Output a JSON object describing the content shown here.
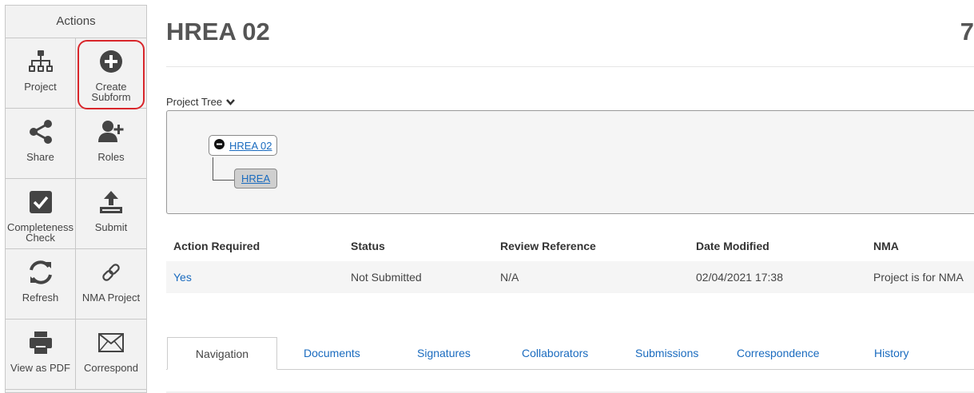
{
  "sidebar": {
    "header": "Actions",
    "items": [
      {
        "label": "Project",
        "icon": "sitemap-icon"
      },
      {
        "label": "Create Subform",
        "icon": "plus-circle-icon"
      },
      {
        "label": "Share",
        "icon": "share-icon"
      },
      {
        "label": "Roles",
        "icon": "user-plus-icon"
      },
      {
        "label": "Completeness Check",
        "icon": "check-square-icon"
      },
      {
        "label": "Submit",
        "icon": "upload-icon"
      },
      {
        "label": "Refresh",
        "icon": "refresh-icon"
      },
      {
        "label": "NMA Project",
        "icon": "link-icon"
      },
      {
        "label": "View as PDF",
        "icon": "print-icon"
      },
      {
        "label": "Correspond",
        "icon": "envelope-icon"
      }
    ]
  },
  "header": {
    "title": "HREA 02",
    "right_number": "7"
  },
  "tree": {
    "label": "Project Tree",
    "root": "HREA 02",
    "child": "HREA"
  },
  "info": {
    "columns": [
      "Action Required",
      "Status",
      "Review Reference",
      "Date Modified",
      "NMA"
    ],
    "row": [
      "Yes",
      "Not Submitted",
      "N/A",
      "02/04/2021 17:38",
      "Project is for NMA"
    ]
  },
  "tabs": [
    "Navigation",
    "Documents",
    "Signatures",
    "Collaborators",
    "Submissions",
    "Correspondence",
    "History"
  ],
  "colors": {
    "link": "#1a6bbf",
    "highlight": "#d9262b",
    "icon": "#444444"
  }
}
